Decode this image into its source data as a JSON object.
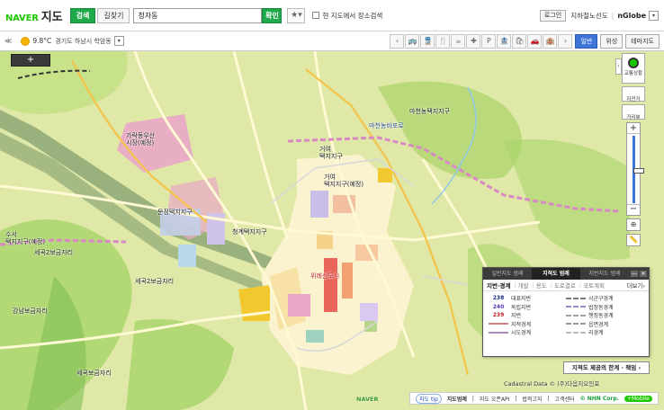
{
  "header": {
    "logo_naver": "NAVER",
    "logo_map": "지도",
    "tabs": [
      {
        "label": "검색",
        "active": true
      },
      {
        "label": "길찾기",
        "active": false
      }
    ],
    "search_value": "청자동",
    "search_button": "확인",
    "favorites": "★▾",
    "checkbox_label": "현 지도에서 장소검색",
    "login": "로그인",
    "link_tools": "지하철노선도",
    "link_nglobe": "nGlobe",
    "dropdown": "▾"
  },
  "subbar": {
    "collapse": "≪",
    "temperature": "9.8°C",
    "weather_text": "경기도 하남시 학암동",
    "dropdown": "▾",
    "poi_icons": [
      "chevron-left-icon",
      "bus-icon",
      "subway-icon",
      "restaurant-icon",
      "cafe-icon",
      "hospital-icon",
      "parking-icon",
      "bank-icon",
      "shopping-icon",
      "car-icon",
      "hotel-icon",
      "chevron-right-icon"
    ],
    "poi_glyphs": [
      "‹",
      "🚌",
      "🚆",
      "🍴",
      "☕",
      "✚",
      "P",
      "🏦",
      "🛍",
      "🚗",
      "🏨",
      "›"
    ],
    "map_types": [
      {
        "label": "일반",
        "active": true
      },
      {
        "label": "위성",
        "active": false
      },
      {
        "label": "테마지도",
        "active": false
      }
    ]
  },
  "map": {
    "zoom_plus": "+",
    "labels": [
      {
        "text": "마천농바포로",
        "cls": "blue"
      },
      {
        "text": "거여\n택지지구",
        "cls": ""
      },
      {
        "text": "거여\n택지지구(예정)",
        "cls": ""
      },
      {
        "text": "문정택지지구",
        "cls": ""
      },
      {
        "text": "청계택지지구",
        "cls": ""
      },
      {
        "text": "위례신도시",
        "cls": "red"
      },
      {
        "text": "수서\n택지지구(예정)",
        "cls": ""
      },
      {
        "text": "세곡2보금자리",
        "cls": ""
      },
      {
        "text": "세곡2보금자리",
        "cls": ""
      },
      {
        "text": "강남보금자리",
        "cls": ""
      },
      {
        "text": "세곡보금자리",
        "cls": ""
      },
      {
        "text": "마천농택지지구",
        "cls": ""
      },
      {
        "text": "가락동우산\n시장(예정)",
        "cls": ""
      }
    ]
  },
  "controls": {
    "traffic_label": "교통상황",
    "bike_label": "자전거",
    "walk_label": "거리뷰",
    "arrow": "‹",
    "zoom_in": "+",
    "zoom_out": "−",
    "zoom_level": 0.52,
    "tool1": "⊕",
    "tool2": "📏"
  },
  "legend": {
    "tabs": [
      {
        "label": "일반지도 범례",
        "active": false
      },
      {
        "label": "지적도 범례",
        "active": true
      },
      {
        "label": "지번지도 범례",
        "active": false
      }
    ],
    "win_buttons": [
      "—",
      "✕"
    ],
    "subtabs": [
      {
        "label": "지번·경계",
        "active": true
      },
      {
        "label": "개발",
        "active": false
      },
      {
        "label": "용도",
        "active": false
      },
      {
        "label": "도로결로",
        "active": false
      },
      {
        "label": "국토계획",
        "active": false
      }
    ],
    "more": "더보기›",
    "left_items": [
      {
        "symbol": "238",
        "color": "#1b2c8c",
        "label": "대표지번"
      },
      {
        "symbol": "240",
        "color": "#5a3ab0",
        "label": "독립지번"
      },
      {
        "symbol": "239",
        "color": "#c02020",
        "label": "지번"
      },
      {
        "symbol": "",
        "color": "#d08080",
        "label": "지적경계"
      },
      {
        "symbol": "",
        "color": "#b088c0",
        "label": "시도경계"
      }
    ],
    "right_items": [
      {
        "color": "#7a7a7a",
        "label": "시군구경계"
      },
      {
        "color": "#8c8cc8",
        "label": "법정동경계"
      },
      {
        "color": "#a0a0a0",
        "label": "행정동경계"
      },
      {
        "color": "#999999",
        "label": "읍면경계"
      },
      {
        "color": "#bbbbbb",
        "label": "리경계"
      }
    ]
  },
  "cadastral_limit": "지적도 제공의 한계 · 책임 ›",
  "cadastral_credit": "Cadastral Data © (주)다음지오인포",
  "naver_watermark": "NAVER",
  "footer": {
    "help": "지도 tip",
    "legend": "지도범례",
    "api": "지도 오픈API",
    "copyright": "법적고지",
    "customer": "고객센터",
    "nhn": "© NHN Corp.",
    "mobile": "+Mobile"
  },
  "colors": {
    "naver_green": "#1ec800",
    "button_green": "#20a94b",
    "accent_blue": "#3c74d8",
    "map_base": "#dfe8a6"
  }
}
